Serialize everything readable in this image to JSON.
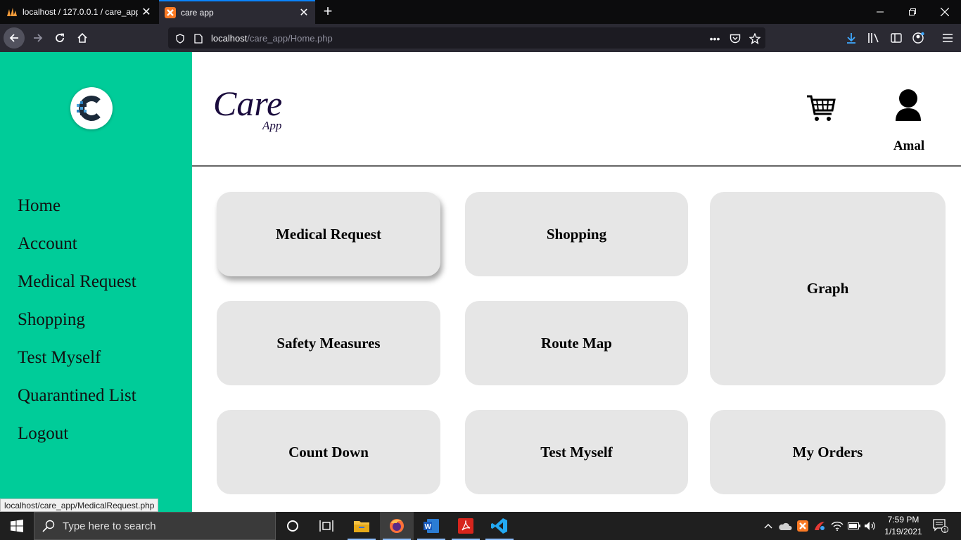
{
  "browser": {
    "tabs": [
      {
        "title": "localhost / 127.0.0.1 / care_app"
      },
      {
        "title": "care app"
      }
    ],
    "url": {
      "host": "localhost",
      "path": "/care_app/Home.php"
    },
    "status_text": "localhost/care_app/MedicalRequest.php"
  },
  "sidebar": {
    "items": [
      {
        "label": "Home"
      },
      {
        "label": "Account"
      },
      {
        "label": "Medical Request"
      },
      {
        "label": "Shopping"
      },
      {
        "label": "Test Myself"
      },
      {
        "label": "Quarantined List"
      },
      {
        "label": "Logout"
      }
    ]
  },
  "header": {
    "brand_main": "Care",
    "brand_sub": "App",
    "username": "Amal"
  },
  "cards": {
    "medical_request": "Medical Request",
    "shopping": "Shopping",
    "graph": "Graph",
    "safety_measures": "Safety Measures",
    "route_map": "Route Map",
    "count_down": "Count Down",
    "test_myself": "Test Myself",
    "my_orders": "My Orders"
  },
  "taskbar": {
    "search_placeholder": "Type here to search",
    "time": "7:59 PM",
    "date": "1/19/2021",
    "notification_count": "1"
  },
  "colors": {
    "sidebar": "#00cc99",
    "card": "#e6e6e6",
    "brand": "#1a0b3d"
  }
}
